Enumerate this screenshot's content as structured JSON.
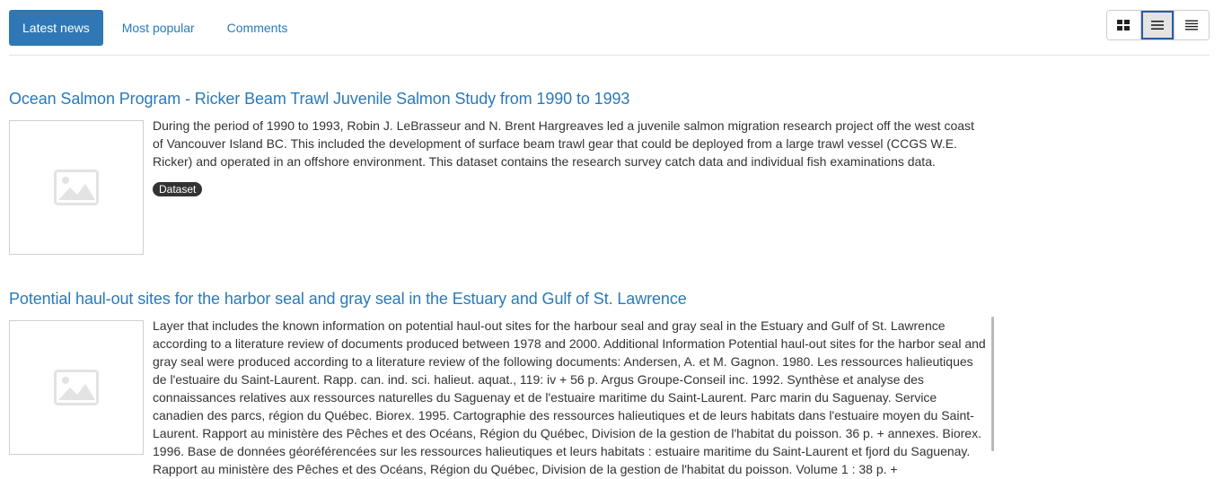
{
  "tabs": [
    {
      "label": "Latest news",
      "active": true
    },
    {
      "label": "Most popular",
      "active": false
    },
    {
      "label": "Comments",
      "active": false
    }
  ],
  "view_modes": [
    {
      "name": "grid-view-icon",
      "active": false
    },
    {
      "name": "list-view-icon",
      "active": true
    },
    {
      "name": "compact-list-view-icon",
      "active": false
    }
  ],
  "items": [
    {
      "title": "Ocean Salmon Program - Ricker Beam Trawl Juvenile Salmon Study from 1990 to 1993",
      "description": "During the period of 1990 to 1993, Robin J. LeBrasseur and N. Brent Hargreaves led a juvenile salmon migration research project off the west coast of Vancouver Island BC. This included the development of surface beam trawl gear that could be deployed from a large trawl vessel (CCGS W.E. Ricker) and operated in an offshore environment. This dataset contains the research survey catch data and individual fish examinations data.",
      "badge": "Dataset"
    },
    {
      "title": "Potential haul-out sites for the harbor seal and gray seal in the Estuary and Gulf of St. Lawrence",
      "description": "Layer that includes the known information on potential haul-out sites for the harbour seal and gray seal in the Estuary and Gulf of St. Lawrence according to a literature review of documents produced between 1978 and 2000. Additional Information Potential haul-out sites for the harbor seal and gray seal were produced according to a literature review of the following documents: Andersen, A. et M. Gagnon. 1980. Les ressources halieutiques de l'estuaire du Saint-Laurent. Rapp. can. ind. sci. halieut. aquat., 119: iv + 56 p. Argus Groupe-Conseil inc. 1992. Synthèse et analyse des connaissances relatives aux ressources naturelles du Saguenay et de l'estuaire maritime du Saint-Laurent. Parc marin du Saguenay. Service canadien des parcs, région du Québec. Biorex. 1995. Cartographie des ressources halieutiques et de leurs habitats dans l'estuaire moyen du Saint-Laurent. Rapport au ministère des Pêches et des Océans, Région du Québec, Division de la gestion de l'habitat du poisson. 36 p. + annexes. Biorex. 1996. Base de données géoréférencées sur les ressources halieutiques et leurs habitats : estuaire maritime du Saint-Laurent et fjord du Saguenay. Rapport au ministère des Pêches et des Océans, Région du Québec, Division de la gestion de l'habitat du poisson. Volume 1 : 38 p. +"
    }
  ]
}
